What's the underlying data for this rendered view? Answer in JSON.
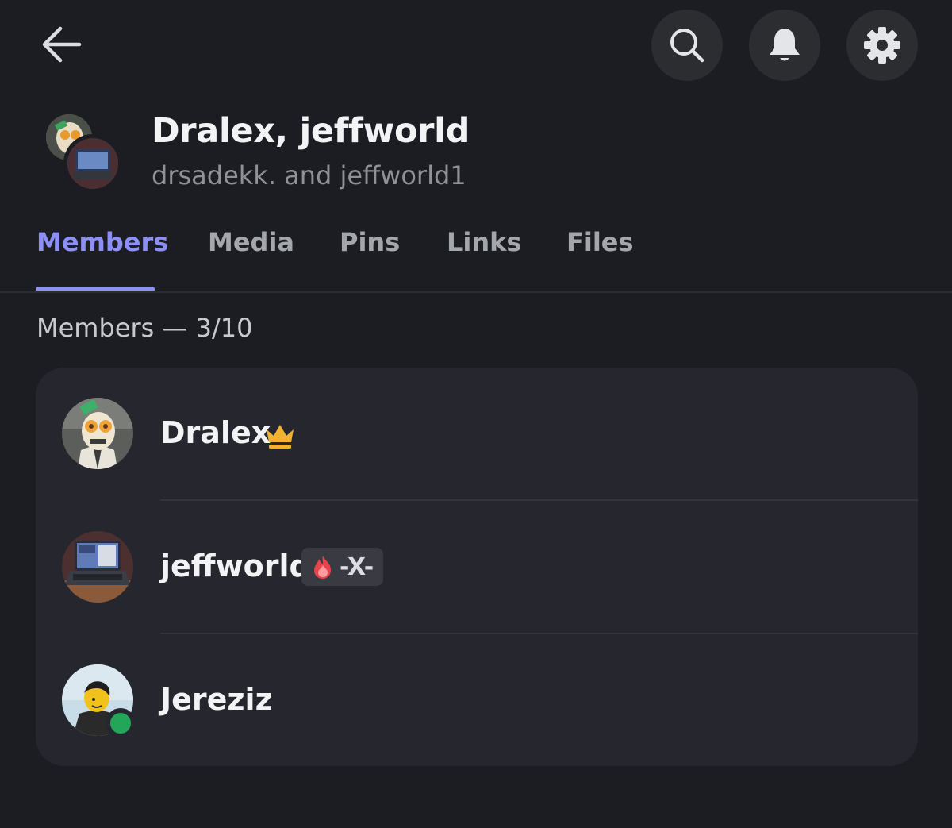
{
  "header": {
    "back_icon": "arrow-left-icon",
    "actions": [
      {
        "name": "search",
        "icon": "search-icon"
      },
      {
        "name": "notifications",
        "icon": "bell-icon"
      },
      {
        "name": "settings",
        "icon": "gear-icon"
      }
    ]
  },
  "group": {
    "title": "Dralex, jeffworld",
    "subtitle": "drsadekk. and jeffworld1"
  },
  "tabs": [
    {
      "label": "Members",
      "active": true
    },
    {
      "label": "Media",
      "active": false
    },
    {
      "label": "Pins",
      "active": false
    },
    {
      "label": "Links",
      "active": false
    },
    {
      "label": "Files",
      "active": false
    }
  ],
  "members_heading": "Members — 3/10",
  "members": [
    {
      "name": "Dralex",
      "badge_icon": "crown-icon"
    },
    {
      "name": "jeffworld",
      "clan_tag": "-X-",
      "clan_icon": "flame-icon"
    },
    {
      "name": "Jereziz",
      "status": "online"
    }
  ],
  "colors": {
    "background": "#1c1d22",
    "card": "#26272e",
    "accent": "#8c8ff5",
    "online": "#23a55a",
    "crown": "#f0b232"
  }
}
